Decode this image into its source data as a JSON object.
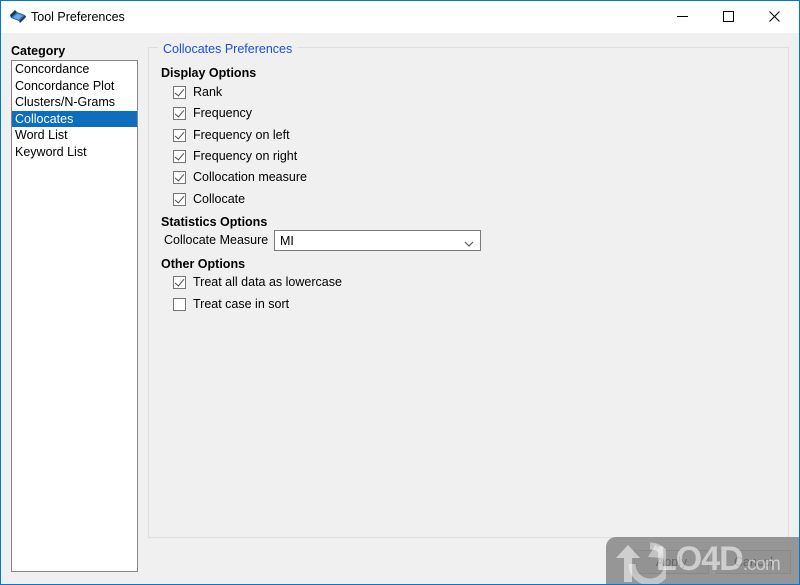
{
  "window": {
    "title": "Tool Preferences",
    "icon": "app-icon",
    "controls": {
      "minimize": "minimize-icon",
      "maximize": "maximize-icon",
      "close": "close-icon"
    },
    "accent_color": "#0078d7",
    "background_color": "#f0f0f0"
  },
  "sidebar": {
    "label": "Category",
    "selected": "Collocates",
    "selected_color": "#0d6ebd",
    "items": [
      {
        "label": "Concordance"
      },
      {
        "label": "Concordance Plot"
      },
      {
        "label": "Clusters/N-Grams"
      },
      {
        "label": "Collocates"
      },
      {
        "label": "Word List"
      },
      {
        "label": "Keyword List"
      }
    ]
  },
  "main": {
    "group_title": "Collocates Preferences",
    "group_title_color": "#1b50d8",
    "display_options": {
      "heading": "Display Options",
      "items": [
        {
          "label": "Rank",
          "checked": true
        },
        {
          "label": "Frequency",
          "checked": true
        },
        {
          "label": "Frequency on left",
          "checked": true
        },
        {
          "label": "Frequency on right",
          "checked": true
        },
        {
          "label": "Collocation measure",
          "checked": true
        },
        {
          "label": "Collocate",
          "checked": true
        }
      ]
    },
    "statistics_options": {
      "heading": "Statistics Options",
      "combo_label": "Collocate Measure",
      "combo_value": "MI",
      "combo_icon": "chevron-down-icon"
    },
    "other_options": {
      "heading": "Other Options",
      "items": [
        {
          "label": "Treat all data as lowercase",
          "checked": true
        },
        {
          "label": "Treat case in sort",
          "checked": false
        }
      ]
    }
  },
  "footer": {
    "apply_label": "Apply",
    "cancel_label": "Cancel"
  },
  "watermark": {
    "text": "LO4D",
    "suffix": ".com",
    "logo": "refresh-arrows-icon"
  }
}
